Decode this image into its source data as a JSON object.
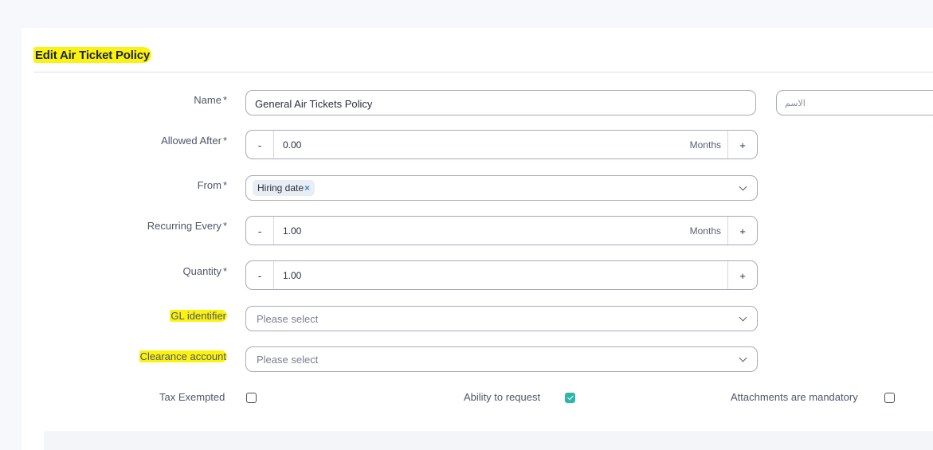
{
  "page": {
    "title": "Edit Air Ticket Policy"
  },
  "form": {
    "name": {
      "label": "Name",
      "required": "*",
      "value": "General Air Tickets Policy",
      "arabic_placeholder": "الاسم"
    },
    "allowed_after": {
      "label": "Allowed After",
      "required": "*",
      "value": "0.00",
      "unit": "Months",
      "minus": "-",
      "plus": "+"
    },
    "from": {
      "label": "From",
      "required": "*",
      "chip": "Hiring date",
      "chip_remove": "×"
    },
    "recurring_every": {
      "label": "Recurring Every",
      "required": "*",
      "value": "1.00",
      "unit": "Months",
      "minus": "-",
      "plus": "+"
    },
    "quantity": {
      "label": "Quantity",
      "required": "*",
      "value": "1.00",
      "minus": "-",
      "plus": "+"
    },
    "gl_identifier": {
      "label": "GL identifier",
      "placeholder": "Please select"
    },
    "clearance_account": {
      "label": "Clearance account",
      "placeholder": "Please select"
    },
    "tax_exempted": {
      "label": "Tax Exempted",
      "checked": false
    },
    "ability_to_request": {
      "label": "Ability to request",
      "checked": true
    },
    "attachments_mandatory": {
      "label": "Attachments are mandatory",
      "checked": false
    }
  },
  "colors": {
    "highlight": "#fbf30f",
    "checkbox_checked": "#2eb6ac",
    "chip_remove": "#2f8fd0"
  }
}
